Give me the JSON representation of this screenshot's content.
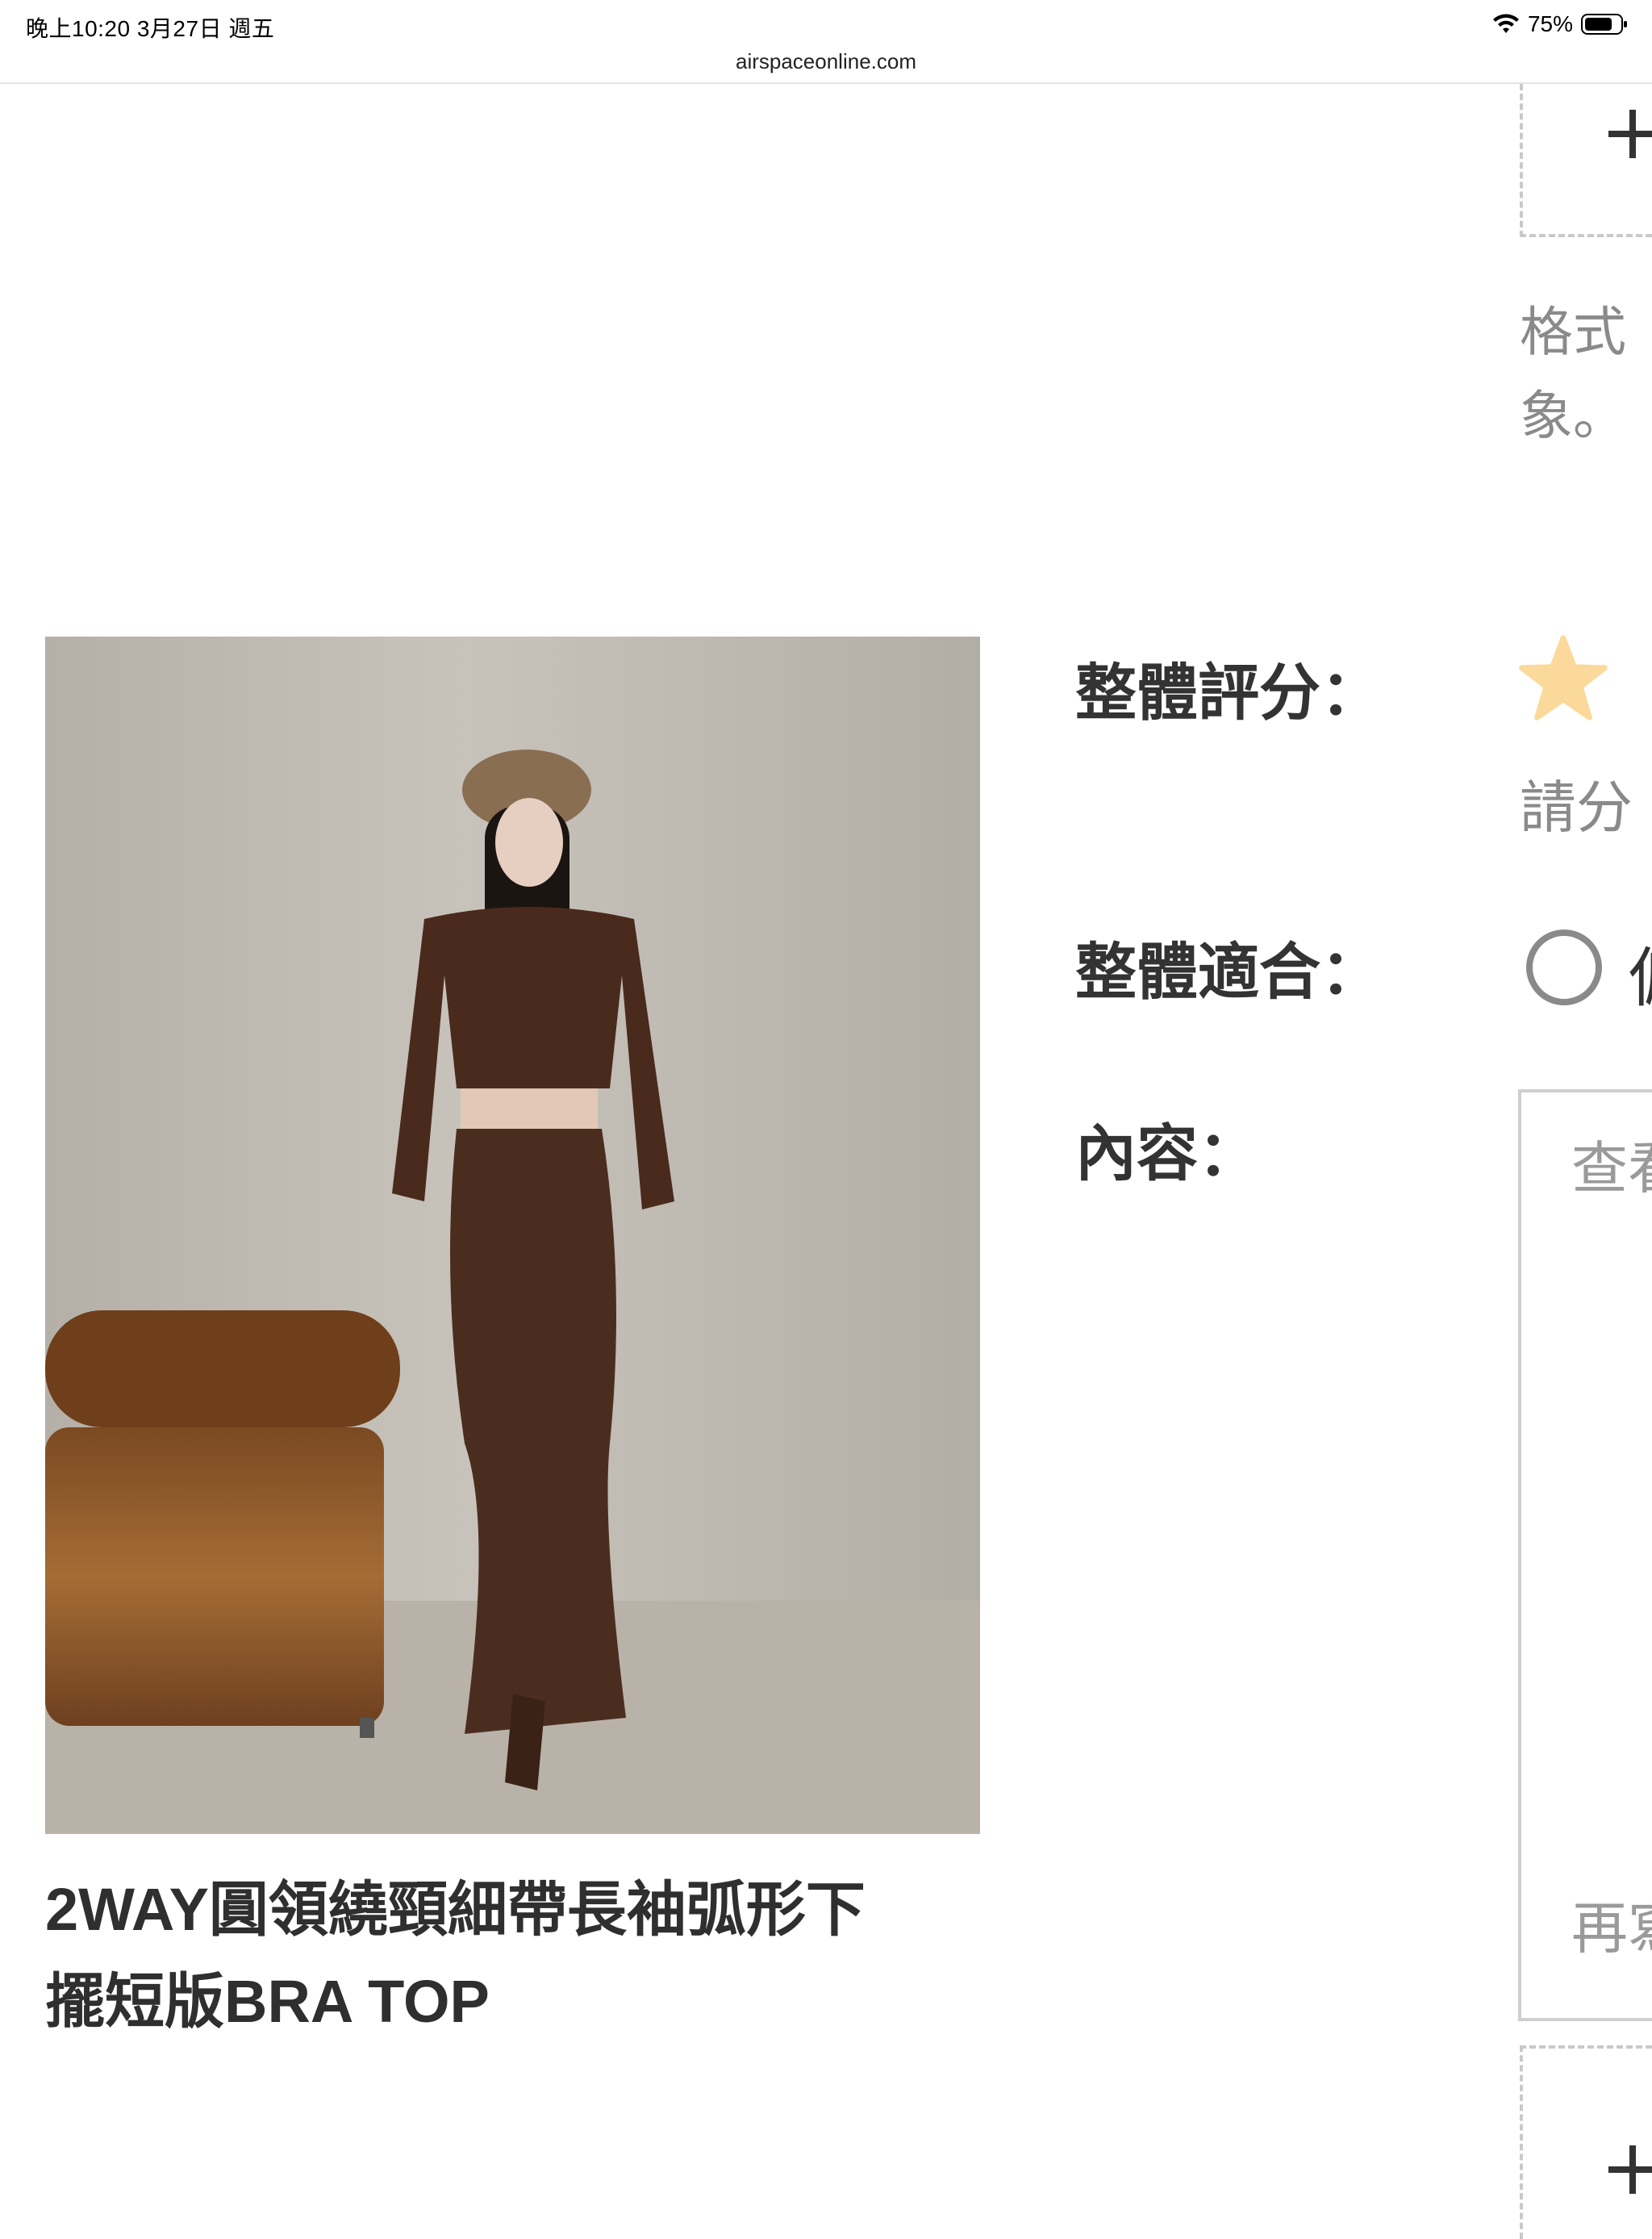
{
  "status_bar": {
    "time_date": "晚上10:20   3月27日 週五",
    "battery": "75%"
  },
  "browser": {
    "url": "airspaceonline.com"
  },
  "upload": {
    "format_note_line1": "格式",
    "format_note_line2": "象。"
  },
  "product": {
    "title_line1": "2WAY圓領繞頸細帶長袖弧形下",
    "title_line2": "擺短版BRA TOP"
  },
  "form": {
    "rating_label": "整體評分：",
    "rating_hint": "請分",
    "fit_label": "整體適合：",
    "fit_option": "偏",
    "content_label": "內容：",
    "content_placeholder": "查看",
    "content_footer": "再寫"
  },
  "colors": {
    "star": "#fbd99a",
    "placeholder": "#9a9a9a",
    "dashed_border": "#c9c9c9"
  }
}
